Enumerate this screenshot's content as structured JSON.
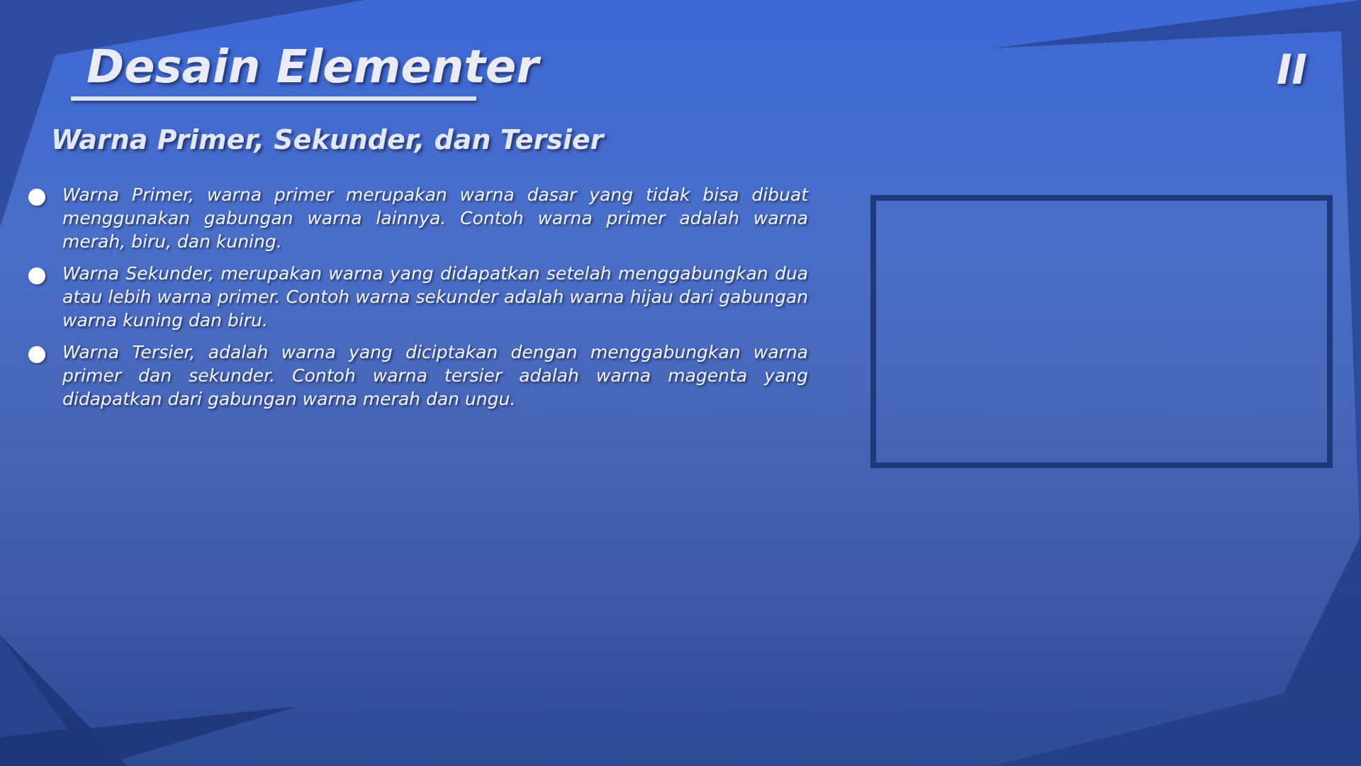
{
  "slide": {
    "title": "Desain Elementer",
    "page_number": "II",
    "subtitle": "Warna Primer, Sekunder, dan Tersier",
    "bullets": [
      {
        "text": "Warna Primer, warna primer merupakan warna dasar yang tidak bisa dibuat menggunakan gabungan warna lainnya. Contoh warna primer adalah warna merah, biru, dan kuning."
      },
      {
        "text": "Warna Sekunder, merupakan warna yang didapatkan setelah menggabungkan dua atau lebih warna primer. Contoh warna sekunder adalah warna hijau dari gabungan warna kuning dan biru."
      },
      {
        "text": "Warna Tersier, adalah warna yang diciptakan dengan menggabungkan warna primer dan sekunder. Contoh warna tersier adalah warna magenta yang didapatkan dari gabungan warna merah dan ungu."
      }
    ]
  },
  "colors": {
    "background_top": "#3c68d6",
    "background_bottom": "#2d4a95",
    "dark_shape": "#203a7c",
    "frame_border": "#1f3a7a",
    "text": "#f3f5fb"
  }
}
